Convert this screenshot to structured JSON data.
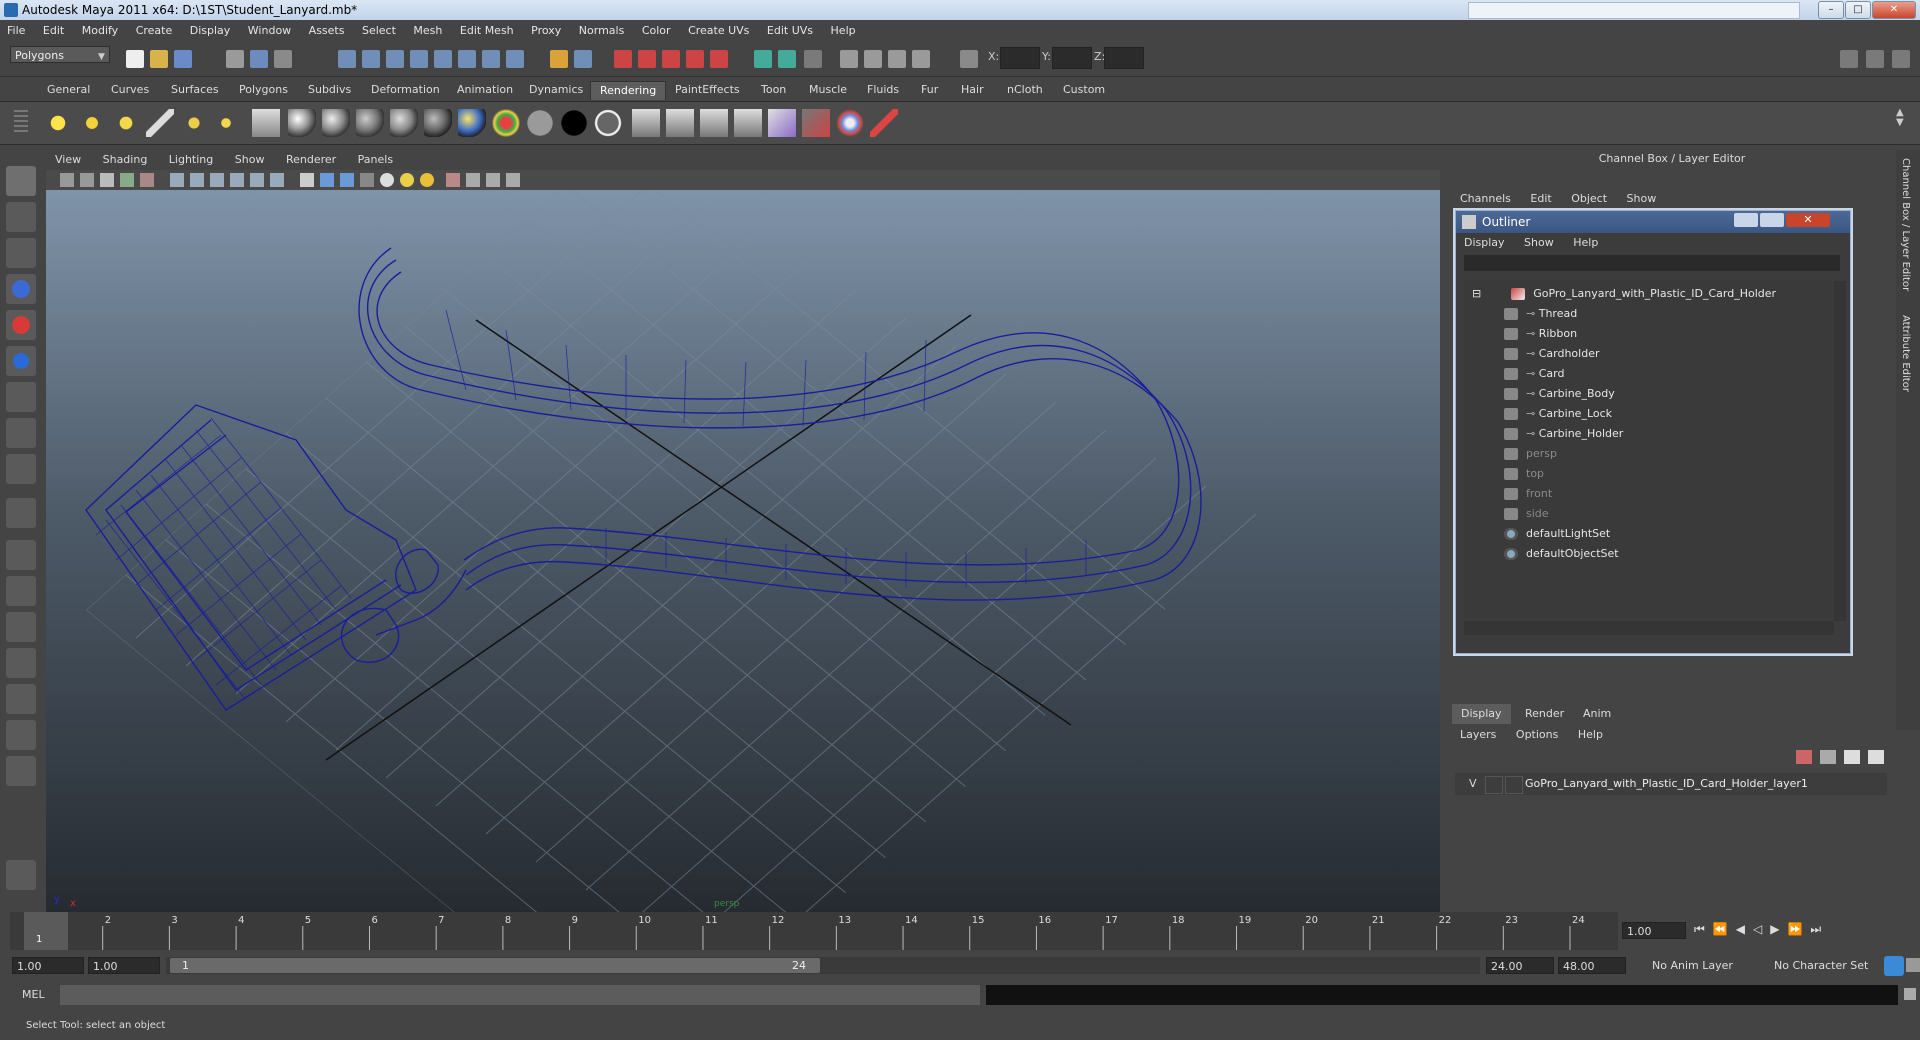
{
  "window": {
    "title": "Autodesk Maya 2011 x64: D:\\1ST\\Student_Lanyard.mb*",
    "min": "–",
    "max": "□",
    "close": "✕"
  },
  "menubar": [
    "File",
    "Edit",
    "Modify",
    "Create",
    "Display",
    "Window",
    "Assets",
    "Select",
    "Mesh",
    "Edit Mesh",
    "Proxy",
    "Normals",
    "Color",
    "Create UVs",
    "Edit UVs",
    "Help"
  ],
  "status": {
    "mode": "Polygons",
    "x_label": "X:",
    "y_label": "Y:",
    "z_label": "Z:"
  },
  "shelf_tabs": [
    "General",
    "Curves",
    "Surfaces",
    "Polygons",
    "Subdivs",
    "Deformation",
    "Animation",
    "Dynamics",
    "Rendering",
    "PaintEffects",
    "Toon",
    "Muscle",
    "Fluids",
    "Fur",
    "Hair",
    "nCloth",
    "Custom"
  ],
  "shelf_active": "Rendering",
  "viewport": {
    "menu": [
      "View",
      "Shading",
      "Lighting",
      "Show",
      "Renderer",
      "Panels"
    ],
    "axis_y": "y",
    "axis_x": "x",
    "camera": "persp"
  },
  "channel_box": {
    "header": "Channel Box / Layer Editor",
    "menu": [
      "Channels",
      "Edit",
      "Object",
      "Show"
    ]
  },
  "outliner": {
    "title": "Outliner",
    "menu": [
      "Display",
      "Show",
      "Help"
    ],
    "items": [
      {
        "label": "GoPro_Lanyard_with_Plastic_ID_Card_Holder",
        "level": 0,
        "type": "group",
        "dim": false
      },
      {
        "label": "Thread",
        "level": 1,
        "type": "mesh",
        "dim": false
      },
      {
        "label": "Ribbon",
        "level": 1,
        "type": "mesh",
        "dim": false
      },
      {
        "label": "Cardholder",
        "level": 1,
        "type": "mesh",
        "dim": false
      },
      {
        "label": "Card",
        "level": 1,
        "type": "mesh",
        "dim": false
      },
      {
        "label": "Carbine_Body",
        "level": 1,
        "type": "mesh",
        "dim": false
      },
      {
        "label": "Carbine_Lock",
        "level": 1,
        "type": "mesh",
        "dim": false
      },
      {
        "label": "Carbine_Holder",
        "level": 1,
        "type": "mesh",
        "dim": false
      },
      {
        "label": "persp",
        "level": 0,
        "type": "camera",
        "dim": true
      },
      {
        "label": "top",
        "level": 0,
        "type": "camera",
        "dim": true
      },
      {
        "label": "front",
        "level": 0,
        "type": "camera",
        "dim": true
      },
      {
        "label": "side",
        "level": 0,
        "type": "camera",
        "dim": true
      },
      {
        "label": "defaultLightSet",
        "level": 0,
        "type": "set",
        "dim": false
      },
      {
        "label": "defaultObjectSet",
        "level": 0,
        "type": "set",
        "dim": false
      }
    ]
  },
  "layers": {
    "tabs": [
      "Display",
      "Render",
      "Anim"
    ],
    "active": "Display",
    "menu": [
      "Layers",
      "Options",
      "Help"
    ],
    "row": {
      "visible": "V",
      "name": "GoPro_Lanyard_with_Plastic_ID_Card_Holder_layer1"
    }
  },
  "vertical_tabs": [
    "Channel Box / Layer Editor",
    "Attribute Editor"
  ],
  "timeline": {
    "ticks": [
      "1",
      "2",
      "3",
      "4",
      "5",
      "6",
      "7",
      "8",
      "9",
      "10",
      "11",
      "12",
      "13",
      "14",
      "15",
      "16",
      "17",
      "18",
      "19",
      "20",
      "21",
      "22",
      "23",
      "24"
    ],
    "current_frame": "1",
    "current_time_field": "1.00"
  },
  "range": {
    "start": "1.00",
    "anim_start": "1.00",
    "slider_start": "1",
    "slider_end": "24",
    "end": "24.00",
    "anim_end": "48.00",
    "anim_layer": "No Anim Layer",
    "char_set": "No Character Set"
  },
  "command": {
    "label": "MEL"
  },
  "help_line": "Select Tool: select an object"
}
